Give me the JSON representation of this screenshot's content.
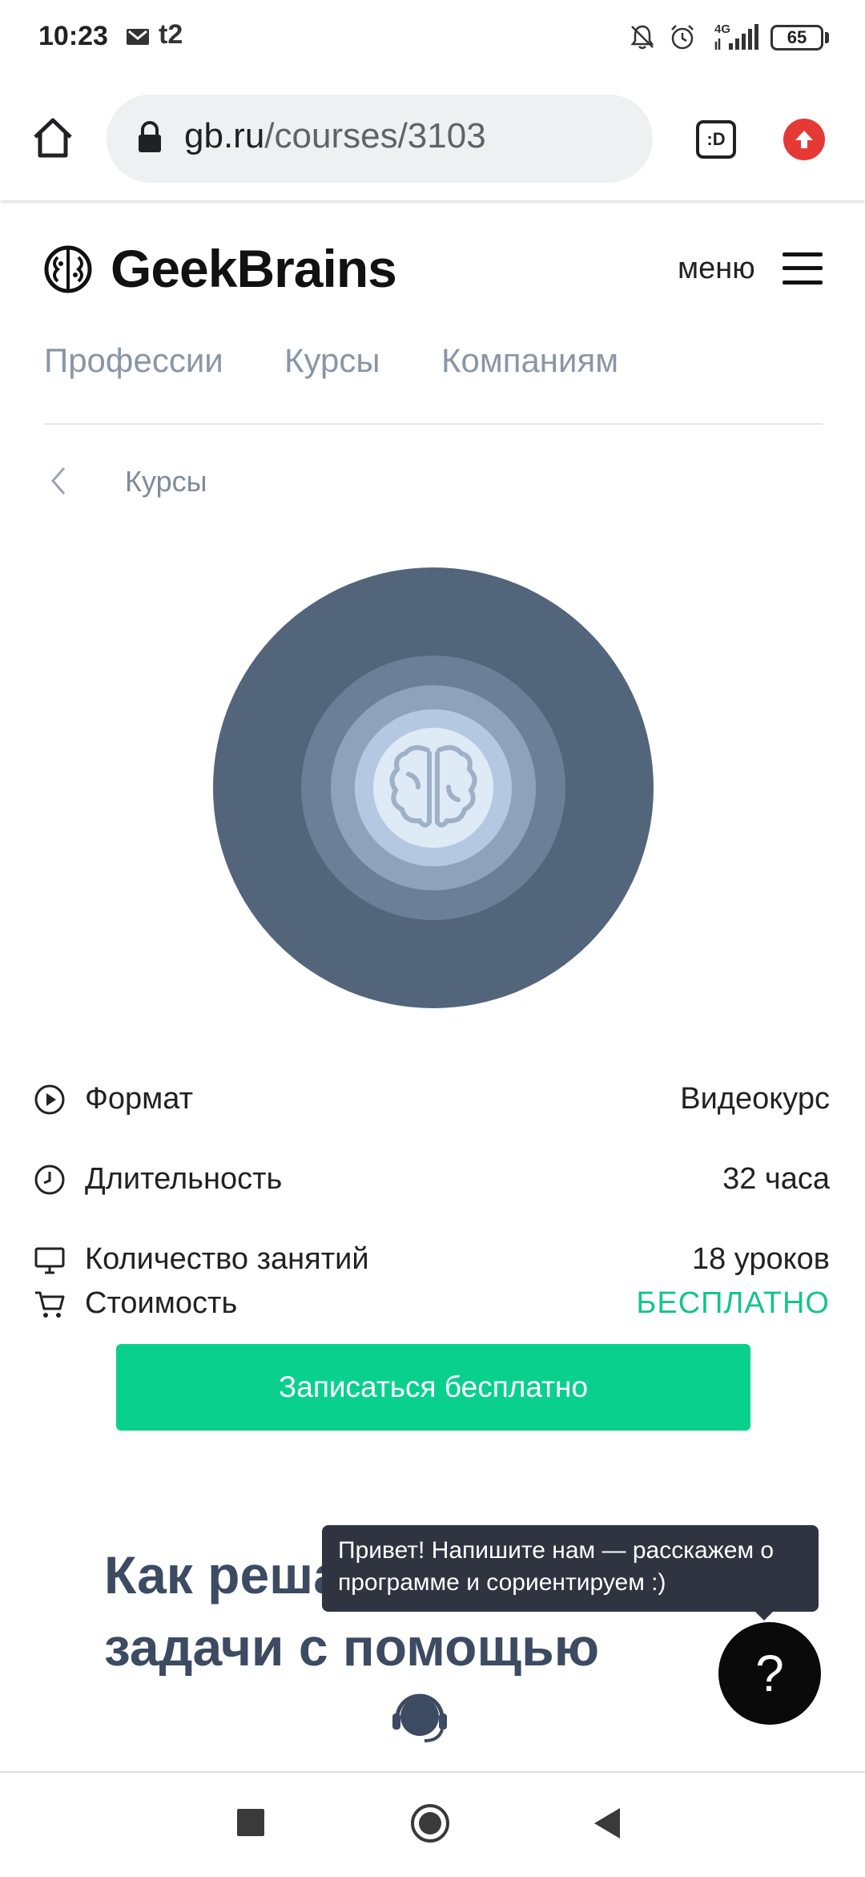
{
  "status_bar": {
    "time": "10:23",
    "carrier": "t2",
    "network": "4G",
    "battery": "65"
  },
  "browser": {
    "url_domain": "gb.ru",
    "url_path": "/courses/3103",
    "tab_count": ":D"
  },
  "header": {
    "logo_text": "GeekBrains",
    "menu_label": "меню"
  },
  "nav": {
    "items": [
      "Профессии",
      "Курсы",
      "Компаниям"
    ]
  },
  "breadcrumb": {
    "label": "Курсы"
  },
  "course_info": [
    {
      "icon": "play-circle-icon",
      "label": "Формат",
      "value": "Видеокурс"
    },
    {
      "icon": "clock-icon",
      "label": "Длительность",
      "value": "32 часа"
    },
    {
      "icon": "monitor-icon",
      "label": "Количество занятий",
      "value": "18 уроков"
    },
    {
      "icon": "cart-icon",
      "label": "Стоимость",
      "value": "БЕСПЛАТНО"
    }
  ],
  "cta": {
    "label": "Записаться бесплатно"
  },
  "section": {
    "heading_line1": "Как решать",
    "heading_line2": "задачи с помощью"
  },
  "chat": {
    "tooltip": "Привет! Напишите нам — расскажем о программе и сориентируем :)",
    "fab_label": "?"
  },
  "colors": {
    "accent": "#0ad08e",
    "price_free": "#15c48c",
    "hero_outer": "#52657a",
    "heading": "#3c4b62"
  }
}
